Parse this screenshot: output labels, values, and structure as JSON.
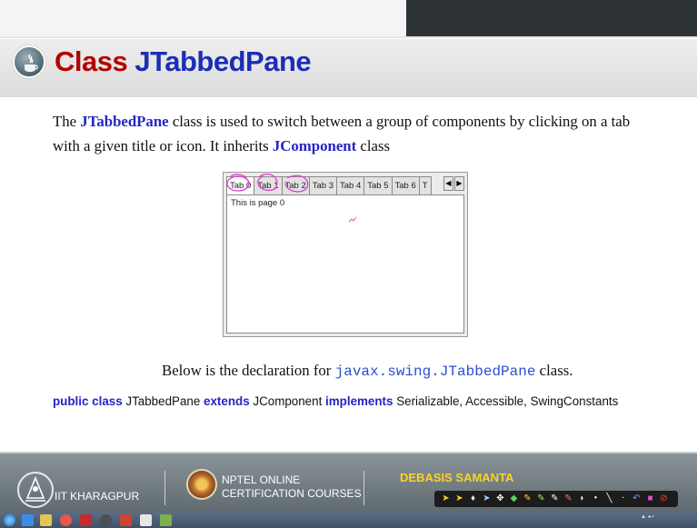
{
  "slide": {
    "title_prefix": "Class",
    "title_name": "JTabbedPane",
    "para_1": "The",
    "para_kw1": "JTabbedPane",
    "para_2": "class is used to switch between a group of components by clicking on a tab with a given title or icon. It inherits",
    "para_kw2": "JComponent",
    "para_3": "class",
    "decl_1": "Below is the declaration for",
    "decl_code": "javax.swing.JTabbedPane",
    "decl_2": "class.",
    "sig": {
      "k1": "public class",
      "t1": "JTabbedPane",
      "k2": "extends",
      "t2": "JComponent",
      "k3": "implements",
      "t3": "Serializable, Accessible, SwingConstants"
    }
  },
  "demo": {
    "tabs": [
      "Tab 0",
      "Tab 1",
      "Tab 2",
      "Tab 3",
      "Tab 4",
      "Tab 5",
      "Tab 6",
      "T"
    ],
    "selected_tab": 0,
    "page_text": "This is page 0",
    "nav_left": "◀",
    "nav_right": "▶"
  },
  "footer": {
    "institute": "IIT KHARAGPUR",
    "nptel_line1": "NPTEL ONLINE",
    "nptel_line2": "CERTIFICATION COURSES",
    "author": "DEBASIS SAMANTA"
  },
  "colors": {
    "title_red": "#b40000",
    "title_blue": "#1b2fb5",
    "keyword_blue": "#2424c8",
    "author_yellow": "#ffd21f"
  }
}
